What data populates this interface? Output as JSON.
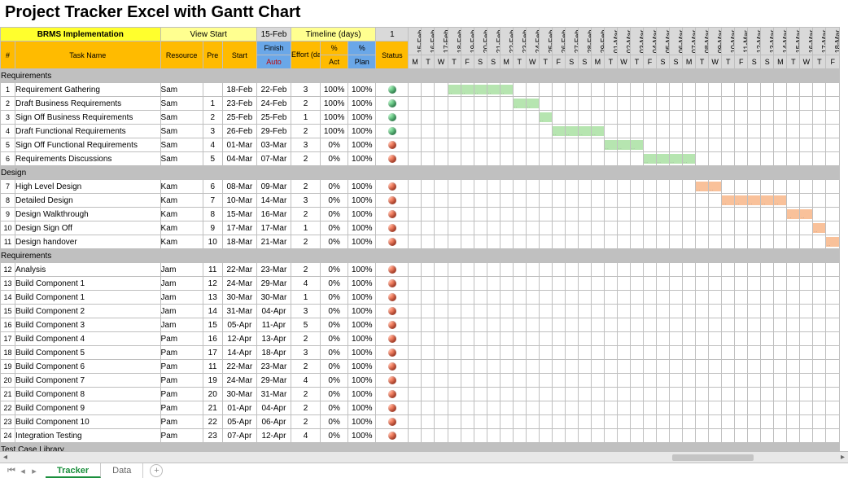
{
  "title": "Project Tracker Excel with Gantt Chart",
  "header": {
    "project_name": "BRMS Implementation",
    "view_start_label": "View Start",
    "view_start_date": "15-Feb",
    "timeline_label": "Timeline (days)",
    "timeline_unit": "1",
    "row_hash": "#",
    "task_name_label": "Task Name",
    "resource_label": "Resource",
    "pre_label": "Pre",
    "start_label": "Start",
    "finish_label": "Finish",
    "auto_label": "Auto",
    "effort_label": "Effort (days)",
    "pct_act_label": "%",
    "pct_plan_label": "%",
    "act_label": "Act",
    "plan_label": "Plan",
    "status_label": "Status"
  },
  "timeline": {
    "dates": [
      "15-Feb",
      "16-Feb",
      "17-Feb",
      "18-Feb",
      "19-Feb",
      "20-Feb",
      "21-Feb",
      "22-Feb",
      "23-Feb",
      "24-Feb",
      "25-Feb",
      "26-Feb",
      "27-Feb",
      "28-Feb",
      "29-Feb",
      "01-Mar",
      "02-Mar",
      "03-Mar",
      "04-Mar",
      "05-Mar",
      "06-Mar",
      "07-Mar",
      "08-Mar",
      "09-Mar",
      "10-Mar",
      "11-Mar",
      "12-Mar",
      "13-Mar",
      "14-Mar",
      "15-Mar",
      "16-Mar",
      "17-Mar",
      "18-Mar"
    ],
    "dows": [
      "M",
      "T",
      "W",
      "T",
      "F",
      "S",
      "S",
      "M",
      "T",
      "W",
      "T",
      "F",
      "S",
      "S",
      "M",
      "T",
      "W",
      "T",
      "F",
      "S",
      "S",
      "M",
      "T",
      "W",
      "T",
      "F",
      "S",
      "S",
      "M",
      "T",
      "W",
      "T",
      "F"
    ]
  },
  "sections": [
    {
      "name": "Requirements",
      "rows": [
        {
          "n": 1,
          "task": "Requirement Gathering",
          "res": "Sam",
          "pre": "",
          "start": "18-Feb",
          "finish": "22-Feb",
          "eff": "3",
          "act": "100%",
          "plan": "100%",
          "status": "green",
          "bar": {
            "color": "green",
            "from": 3,
            "to": 7
          }
        },
        {
          "n": 2,
          "task": "Draft Business Requirements",
          "res": "Sam",
          "pre": "1",
          "start": "23-Feb",
          "finish": "24-Feb",
          "eff": "2",
          "act": "100%",
          "plan": "100%",
          "status": "green",
          "bar": {
            "color": "green",
            "from": 8,
            "to": 9
          }
        },
        {
          "n": 3,
          "task": "Sign Off Business Requirements",
          "res": "Sam",
          "pre": "2",
          "start": "25-Feb",
          "finish": "25-Feb",
          "eff": "1",
          "act": "100%",
          "plan": "100%",
          "status": "green",
          "bar": {
            "color": "green",
            "from": 10,
            "to": 10
          }
        },
        {
          "n": 4,
          "task": "Draft Functional Requirements",
          "res": "Sam",
          "pre": "3",
          "start": "26-Feb",
          "finish": "29-Feb",
          "eff": "2",
          "act": "100%",
          "plan": "100%",
          "status": "green",
          "bar": {
            "color": "green",
            "from": 11,
            "to": 14
          }
        },
        {
          "n": 5,
          "task": "Sign Off Functional Requirements",
          "res": "Sam",
          "pre": "4",
          "start": "01-Mar",
          "finish": "03-Mar",
          "eff": "3",
          "act": "0%",
          "plan": "100%",
          "status": "red",
          "bar": {
            "color": "green",
            "from": 15,
            "to": 17
          }
        },
        {
          "n": 6,
          "task": "Requirements Discussions",
          "res": "Sam",
          "pre": "5",
          "start": "04-Mar",
          "finish": "07-Mar",
          "eff": "2",
          "act": "0%",
          "plan": "100%",
          "status": "red",
          "bar": {
            "color": "green",
            "from": 18,
            "to": 21
          }
        }
      ]
    },
    {
      "name": "Design",
      "rows": [
        {
          "n": 7,
          "task": "High Level Design",
          "res": "Kam",
          "pre": "6",
          "start": "08-Mar",
          "finish": "09-Mar",
          "eff": "2",
          "act": "0%",
          "plan": "100%",
          "status": "red",
          "bar": {
            "color": "orange",
            "from": 22,
            "to": 23
          }
        },
        {
          "n": 8,
          "task": "Detailed Design",
          "res": "Kam",
          "pre": "7",
          "start": "10-Mar",
          "finish": "14-Mar",
          "eff": "3",
          "act": "0%",
          "plan": "100%",
          "status": "red",
          "bar": {
            "color": "orange",
            "from": 24,
            "to": 28
          }
        },
        {
          "n": 9,
          "task": "Design Walkthrough",
          "res": "Kam",
          "pre": "8",
          "start": "15-Mar",
          "finish": "16-Mar",
          "eff": "2",
          "act": "0%",
          "plan": "100%",
          "status": "red",
          "bar": {
            "color": "orange",
            "from": 29,
            "to": 30
          }
        },
        {
          "n": 10,
          "task": "Design Sign Off",
          "res": "Kam",
          "pre": "9",
          "start": "17-Mar",
          "finish": "17-Mar",
          "eff": "1",
          "act": "0%",
          "plan": "100%",
          "status": "red",
          "bar": {
            "color": "orange",
            "from": 31,
            "to": 31
          }
        },
        {
          "n": 11,
          "task": "Design handover",
          "res": "Kam",
          "pre": "10",
          "start": "18-Mar",
          "finish": "21-Mar",
          "eff": "2",
          "act": "0%",
          "plan": "100%",
          "status": "red",
          "bar": {
            "color": "orange",
            "from": 32,
            "to": 32
          }
        }
      ]
    },
    {
      "name": "Requirements",
      "rows": [
        {
          "n": 12,
          "task": "Analysis",
          "res": "Jam",
          "pre": "11",
          "start": "22-Mar",
          "finish": "23-Mar",
          "eff": "2",
          "act": "0%",
          "plan": "100%",
          "status": "red"
        },
        {
          "n": 13,
          "task": "Build Component 1",
          "res": "Jam",
          "pre": "12",
          "start": "24-Mar",
          "finish": "29-Mar",
          "eff": "4",
          "act": "0%",
          "plan": "100%",
          "status": "red"
        },
        {
          "n": 14,
          "task": "Build Component 1",
          "res": "Jam",
          "pre": "13",
          "start": "30-Mar",
          "finish": "30-Mar",
          "eff": "1",
          "act": "0%",
          "plan": "100%",
          "status": "red"
        },
        {
          "n": 15,
          "task": "Build Component 2",
          "res": "Jam",
          "pre": "14",
          "start": "31-Mar",
          "finish": "04-Apr",
          "eff": "3",
          "act": "0%",
          "plan": "100%",
          "status": "red"
        },
        {
          "n": 16,
          "task": "Build Component 3",
          "res": "Jam",
          "pre": "15",
          "start": "05-Apr",
          "finish": "11-Apr",
          "eff": "5",
          "act": "0%",
          "plan": "100%",
          "status": "red"
        },
        {
          "n": 17,
          "task": "Build Component 4",
          "res": "Pam",
          "pre": "16",
          "start": "12-Apr",
          "finish": "13-Apr",
          "eff": "2",
          "act": "0%",
          "plan": "100%",
          "status": "red"
        },
        {
          "n": 18,
          "task": "Build Component 5",
          "res": "Pam",
          "pre": "17",
          "start": "14-Apr",
          "finish": "18-Apr",
          "eff": "3",
          "act": "0%",
          "plan": "100%",
          "status": "red"
        },
        {
          "n": 19,
          "task": "Build Component 6",
          "res": "Pam",
          "pre": "11",
          "start": "22-Mar",
          "finish": "23-Mar",
          "eff": "2",
          "act": "0%",
          "plan": "100%",
          "status": "red"
        },
        {
          "n": 20,
          "task": "Build Component 7",
          "res": "Pam",
          "pre": "19",
          "start": "24-Mar",
          "finish": "29-Mar",
          "eff": "4",
          "act": "0%",
          "plan": "100%",
          "status": "red"
        },
        {
          "n": 21,
          "task": "Build Component 8",
          "res": "Pam",
          "pre": "20",
          "start": "30-Mar",
          "finish": "31-Mar",
          "eff": "2",
          "act": "0%",
          "plan": "100%",
          "status": "red"
        },
        {
          "n": 22,
          "task": "Build Component 9",
          "res": "Pam",
          "pre": "21",
          "start": "01-Apr",
          "finish": "04-Apr",
          "eff": "2",
          "act": "0%",
          "plan": "100%",
          "status": "red"
        },
        {
          "n": 23,
          "task": "Build Component 10",
          "res": "Pam",
          "pre": "22",
          "start": "05-Apr",
          "finish": "06-Apr",
          "eff": "2",
          "act": "0%",
          "plan": "100%",
          "status": "red"
        },
        {
          "n": 24,
          "task": "Integration Testing",
          "res": "Pam",
          "pre": "23",
          "start": "07-Apr",
          "finish": "12-Apr",
          "eff": "4",
          "act": "0%",
          "plan": "100%",
          "status": "red"
        }
      ]
    },
    {
      "name": "Test Case Library",
      "rows": []
    }
  ],
  "tabs": {
    "active": "Tracker",
    "items": [
      "Tracker",
      "Data"
    ]
  }
}
